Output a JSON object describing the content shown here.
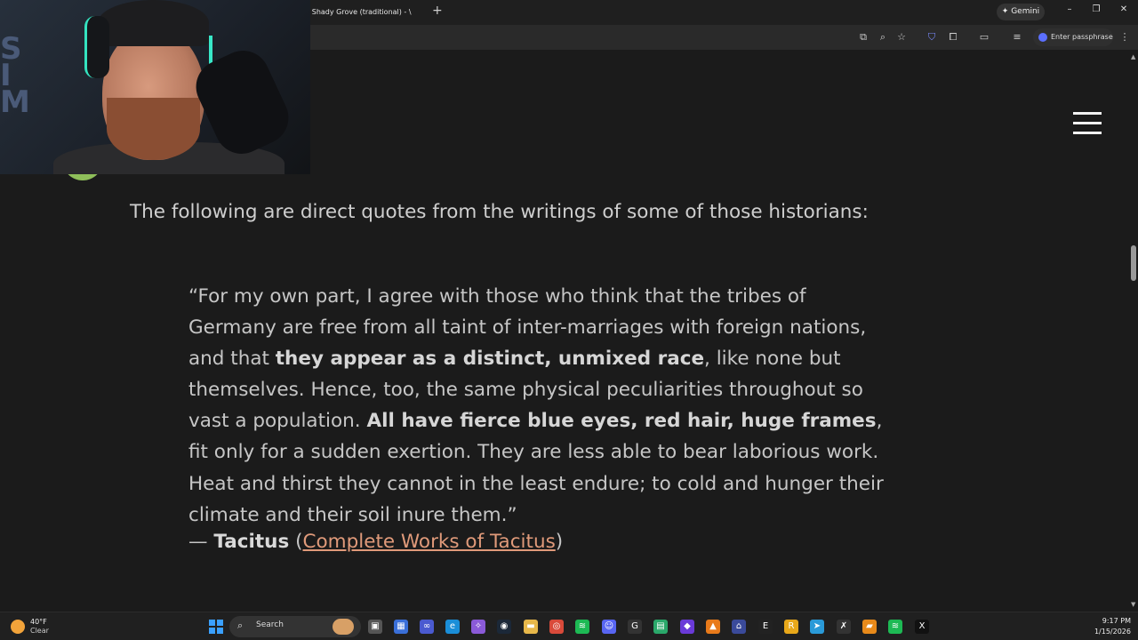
{
  "browser": {
    "tab_title": "3) Shady Grove (traditional) - \\",
    "new_tab_symbol": "+",
    "gemini_label": "Gemini",
    "password_manager_label": "Enter passphrase",
    "window_buttons": [
      "–",
      "❐",
      "✕"
    ]
  },
  "page": {
    "intro": "The following are direct quotes from the writings of some of those historians:",
    "quote": {
      "open": "“For my own part, I agree with those who think that the tribes of Germany are free from all taint of inter-marriages with foreign nations, and that ",
      "bold1": "they appear as a distinct, unmixed race",
      "mid": ", like none but themselves. Hence, too, the same physical peculiarities throughout so vast a population. ",
      "bold2": "All have fierce blue eyes, red hair, huge frames",
      "close": ", fit only for a sudden exertion. They are less able to bear laborious work. Heat and thirst they cannot in the least endure; to cold and hunger their climate and their soil inure them.”"
    },
    "citation": {
      "dash": "— ",
      "author": "Tacitus",
      "paren_open": " (",
      "link_text": "Complete Works of Tacitus",
      "paren_close": ")"
    }
  },
  "webcam": {
    "bg_letters": "S\nI\nM"
  },
  "taskbar": {
    "weather_temp": "40°F",
    "weather_condition": "Clear",
    "search_label": "Search",
    "time": "9:17 PM",
    "date": "1/15/2026"
  },
  "colors": {
    "page_background": "#1b1b1b",
    "link": "#e09a7a",
    "accent_blue": "#3aa0ff"
  }
}
